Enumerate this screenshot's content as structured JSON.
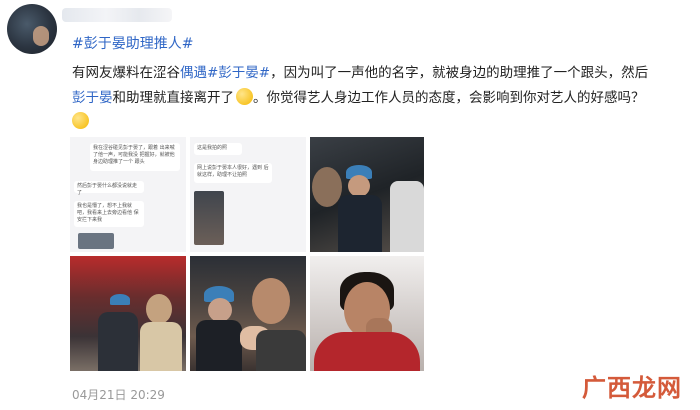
{
  "post": {
    "topic": "#彭于晏助理推人#",
    "line1_a": "有网友爆料在涩谷",
    "line1_link1": "偶遇",
    "line1_link2": "#彭于晏#",
    "line1_b": "，因为叫了一声他的名字，就被身边的助理推了一个跟头，然后",
    "line2_link": "彭于晏",
    "line2_a": "和助理就直接离开了",
    "line2_b": "。你觉得艺人身边工作人员的态度，会影响到你对艺人的好感吗？",
    "timestamp": "04月21日 20:29"
  },
  "chat1": {
    "b1": "我在涩谷碰见彭于晏了，跟着 出来喊了他一声，可能我没 把握好，就被他身边助理推了一个 跟头",
    "b2": "然后彭于晏什么都没说就走了",
    "b3": "我也是懵了，想不上我就 吧，我看来上去旁边看他 保安拦下来我"
  },
  "chat2": {
    "b1": "这是我拍的照",
    "b2": "网上说彭于晏本人很好，遇到 后就这样，助理不让拍照"
  },
  "watermark": "广西龙网",
  "colors": {
    "link": "#2f66c6",
    "watermark": "#d45a3a"
  }
}
